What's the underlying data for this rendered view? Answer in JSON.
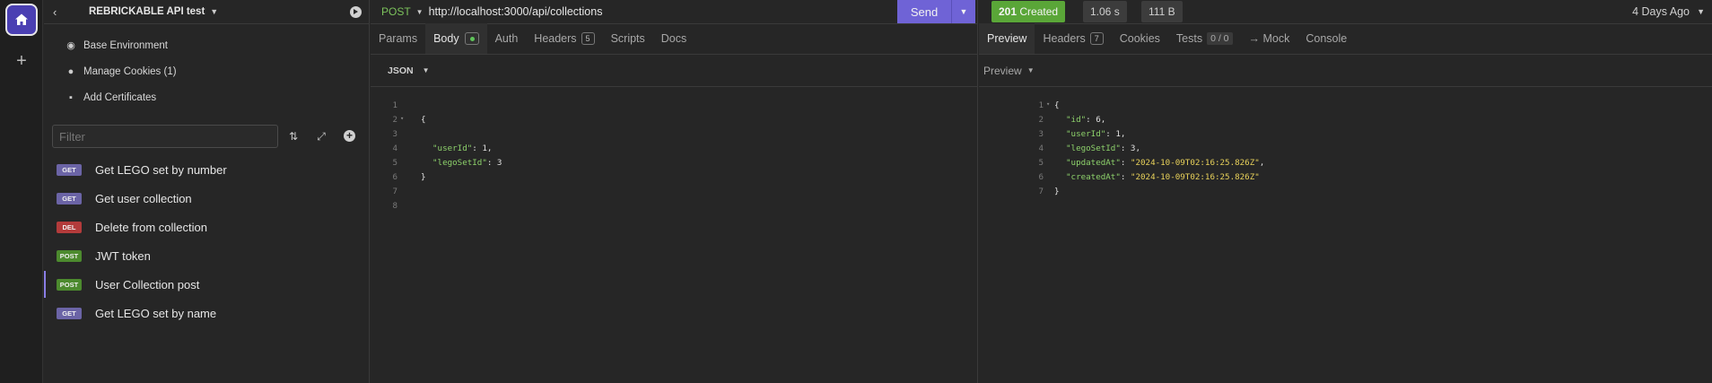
{
  "rail": {
    "home_icon": "home-icon",
    "add_icon": "plus-icon"
  },
  "sidebar": {
    "title": "REBRICKABLE API test",
    "environment_items": [
      {
        "label": "Base Environment",
        "icon": "globe-icon"
      },
      {
        "label": "Manage Cookies (1)",
        "icon": "cookie-icon"
      },
      {
        "label": "Add Certificates",
        "icon": "certificate-icon"
      }
    ],
    "filter_placeholder": "Filter",
    "requests": [
      {
        "method": "GET",
        "name": "Get LEGO set by number"
      },
      {
        "method": "GET",
        "name": "Get user collection"
      },
      {
        "method": "DEL",
        "name": "Delete from collection"
      },
      {
        "method": "POST",
        "name": "JWT token"
      },
      {
        "method": "POST",
        "name": "User Collection post",
        "active": true
      },
      {
        "method": "GET",
        "name": "Get LEGO set by name"
      }
    ]
  },
  "request": {
    "method": "POST",
    "url": "http://localhost:3000/api/collections",
    "send_label": "Send",
    "tabs": [
      {
        "label": "Params"
      },
      {
        "label": "Body",
        "selected": true
      },
      {
        "label": "Auth"
      },
      {
        "label": "Headers",
        "count": "5"
      },
      {
        "label": "Scripts"
      },
      {
        "label": "Docs"
      }
    ],
    "body_format": "JSON",
    "body_lines": [
      "1",
      "2",
      "3",
      "4",
      "5",
      "6",
      "7",
      "8"
    ],
    "body_code": {
      "l2": "{",
      "l4_key": "\"userId\"",
      "l4_rest": ": 1,",
      "l5_key": "\"legoSetId\"",
      "l5_rest": ": 3",
      "l6": "}"
    }
  },
  "response": {
    "status": "201",
    "status_text": "Created",
    "time": "1.06 s",
    "size": "111 B",
    "ago": "4 Days Ago",
    "tabs": [
      {
        "label": "Preview",
        "selected": true
      },
      {
        "label": "Headers",
        "count": "7"
      },
      {
        "label": "Cookies"
      },
      {
        "label": "Tests",
        "count": "0 / 0"
      },
      {
        "label": "→ Mock"
      },
      {
        "label": "Console"
      }
    ],
    "preview_label": "Preview",
    "lines": [
      "1",
      "2",
      "3",
      "4",
      "5",
      "6",
      "7"
    ],
    "code": {
      "l1": "{",
      "l2_key": "\"id\"",
      "l2_rest": ": 6,",
      "l3_key": "\"userId\"",
      "l3_rest": ": 1,",
      "l4_key": "\"legoSetId\"",
      "l4_rest": ": 3,",
      "l5_key": "\"updatedAt\"",
      "l5_val": "\"2024-10-09T02:16:25.826Z\"",
      "l5_rest": ",",
      "l6_key": "\"createdAt\"",
      "l6_val": "\"2024-10-09T02:16:25.826Z\"",
      "l7": "}"
    }
  }
}
